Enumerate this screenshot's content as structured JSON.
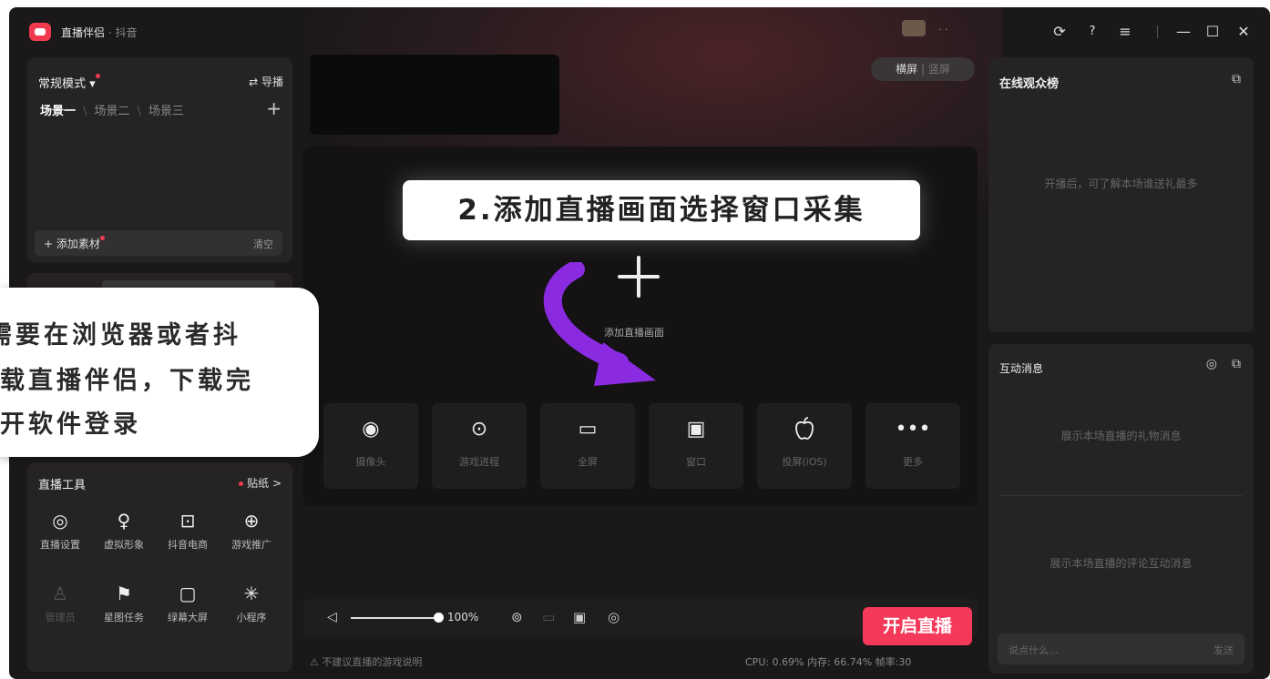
{
  "titlebar": {
    "app_name": "直播伴侣",
    "app_sub": " · 抖音",
    "user_name": "· ·",
    "icons": [
      "headset-icon",
      "help-icon",
      "menu-icon",
      "minimize-icon",
      "maximize-icon",
      "close-icon"
    ],
    "glyphs": {
      "headset": "⟳",
      "help": "?",
      "menu": "≡",
      "minimize": "—",
      "maximize": "☐",
      "close": "✕"
    }
  },
  "scene_panel": {
    "mode": "常规模式 ▾",
    "guide": "⇄ 导播",
    "scenes": [
      "场景一",
      "场景二",
      "场景三"
    ],
    "add_scene": "+",
    "add_material": "+ 添加素材",
    "clear": "清空"
  },
  "tools": {
    "title": "直播工具",
    "sticker": "贴纸 >",
    "items": [
      {
        "label": "直播设置",
        "icon": "◎",
        "icon_name": "settings-icon"
      },
      {
        "label": "虚拟形象",
        "icon": "♀",
        "icon_name": "avatar-icon"
      },
      {
        "label": "抖音电商",
        "icon": "⊡",
        "icon_name": "cart-icon"
      },
      {
        "label": "游戏推广",
        "icon": "⊕",
        "icon_name": "gamepad-icon"
      },
      {
        "label": "管理员",
        "icon": "♙",
        "icon_name": "admin-icon"
      },
      {
        "label": "星图任务",
        "icon": "⚑",
        "icon_name": "star-task-icon"
      },
      {
        "label": "绿幕大屏",
        "icon": "▢",
        "icon_name": "screen-icon"
      },
      {
        "label": "小程序",
        "icon": "✳",
        "icon_name": "miniapp-icon"
      }
    ]
  },
  "orientation": {
    "landscape": "横屏",
    "portrait": "竖屏"
  },
  "stage": {
    "add_label": "添加直播画面",
    "sources": [
      {
        "label": "摄像头",
        "icon": "◉",
        "icon_name": "camera-icon"
      },
      {
        "label": "游戏进程",
        "icon": "⊙",
        "icon_name": "game-process-icon"
      },
      {
        "label": "全屏",
        "icon": "▭",
        "icon_name": "monitor-icon"
      },
      {
        "label": "窗口",
        "icon": "▣",
        "icon_name": "window-icon"
      },
      {
        "label": "投屏(iOS)",
        "icon": "",
        "icon_name": "apple-icon"
      },
      {
        "label": "更多",
        "icon": "•••",
        "icon_name": "more-icon"
      }
    ]
  },
  "annotations": {
    "callout": "2.添加直播画面选择窗口采集",
    "bubble": [
      "需要在浏览器或者抖",
      "载直播伴侣，下载完",
      "开软件登录"
    ]
  },
  "controls": {
    "volume_percent": "100%",
    "volume_level": 1.0,
    "start_button": "开启直播",
    "icons": {
      "volume": "◁",
      "camera": "⊚",
      "window": "▭",
      "record": "▣",
      "settings": "◎"
    }
  },
  "status_bar": {
    "warning": "⚠ 不建议直播的游戏说明",
    "stats": "CPU: 0.69%  内存: 66.74%  帧率:30"
  },
  "right_panel": {
    "rank_title": "在线观众榜",
    "rank_empty": "开播后，可了解本场谁送礼最多",
    "msg_title": "互动消息",
    "gift_empty": "展示本场直播的礼物消息",
    "comment_empty": "展示本场直播的评论互动消息",
    "chat_placeholder": "说点什么...",
    "send": "发送",
    "external_icon": "⧉",
    "settings_icon": "◎"
  },
  "colors": {
    "accent": "#f5395a",
    "arrow": "#8a2be2",
    "panel": "#262325",
    "background": "#1b1819"
  }
}
